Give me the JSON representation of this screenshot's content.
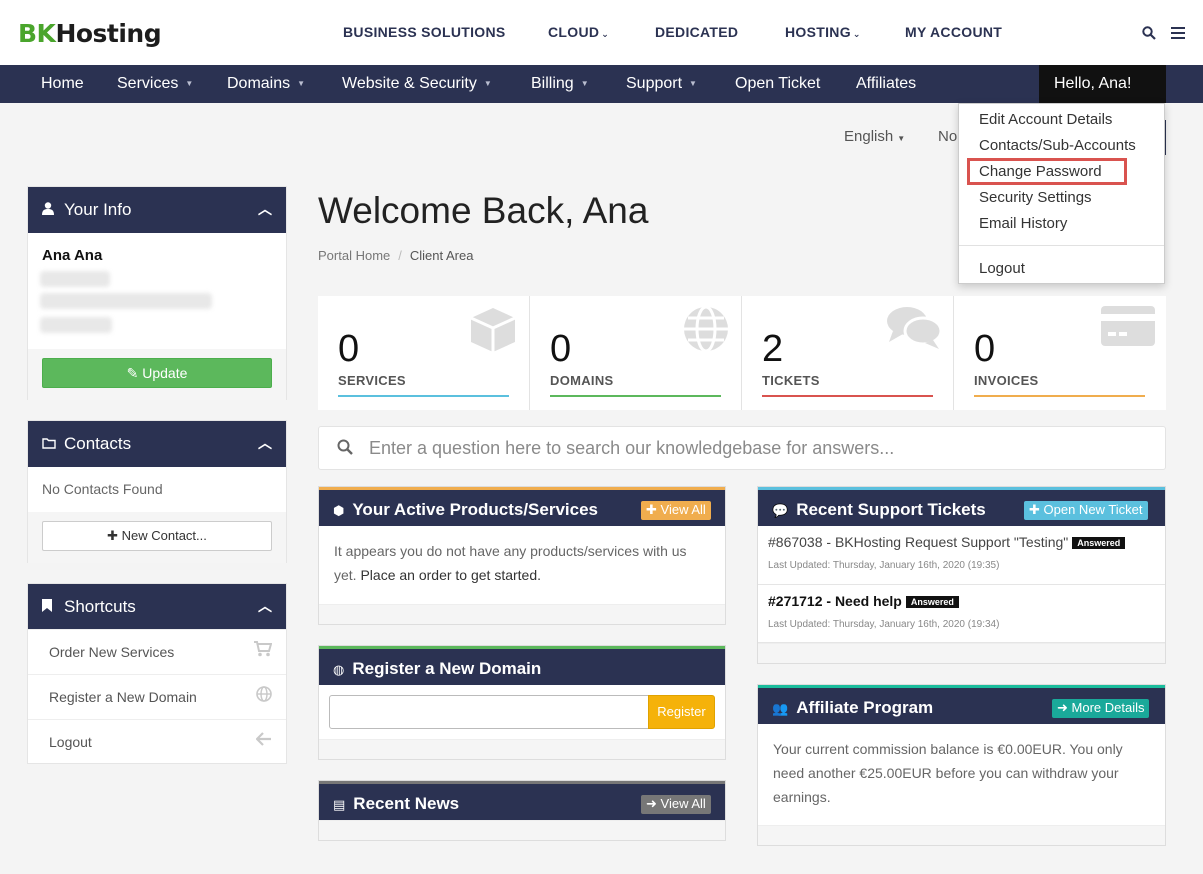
{
  "brand": {
    "bk": "BK",
    "hosting": "Hosting"
  },
  "topnav": [
    {
      "label": "BUSINESS SOLUTIONS",
      "caret": ""
    },
    {
      "label": "CLOUD",
      "caret": "⌄"
    },
    {
      "label": "DEDICATED",
      "caret": ""
    },
    {
      "label": "HOSTING",
      "caret": "⌄"
    },
    {
      "label": "MY ACCOUNT",
      "caret": ""
    }
  ],
  "mainnav": [
    {
      "label": "Home"
    },
    {
      "label": "Services",
      "caret": "▼"
    },
    {
      "label": "Domains",
      "caret": "▼"
    },
    {
      "label": "Website & Security",
      "caret": "▼"
    },
    {
      "label": "Billing",
      "caret": "▼"
    },
    {
      "label": "Support",
      "caret": "▼"
    },
    {
      "label": "Open Ticket"
    },
    {
      "label": "Affiliates"
    }
  ],
  "user_menu": {
    "hello": "Hello, Ana!",
    "items": [
      "Edit Account Details",
      "Contacts/Sub-Accounts",
      "Change Password",
      "Security Settings",
      "Email History"
    ],
    "logout": "Logout"
  },
  "language": {
    "label": "English",
    "notifications": "No"
  },
  "your_info": {
    "title": "Your Info",
    "name": "Ana Ana",
    "update": "Update"
  },
  "contacts": {
    "title": "Contacts",
    "empty": "No Contacts Found",
    "new_contact": "New Contact..."
  },
  "shortcuts": {
    "title": "Shortcuts",
    "items": [
      "Order New Services",
      "Register a New Domain",
      "Logout"
    ]
  },
  "welcome": "Welcome Back, Ana",
  "breadcrumb": {
    "home": "Portal Home",
    "current": "Client Area"
  },
  "stats": [
    {
      "value": "0",
      "label": "SERVICES",
      "color": "#5bc0de"
    },
    {
      "value": "0",
      "label": "DOMAINS",
      "color": "#5cb85c"
    },
    {
      "value": "2",
      "label": "TICKETS",
      "color": "#d9534f"
    },
    {
      "value": "0",
      "label": "INVOICES",
      "color": "#f0ad4e"
    }
  ],
  "kb_search": {
    "placeholder": "Enter a question here to search our knowledgebase for answers..."
  },
  "products": {
    "title": "Your Active Products/Services",
    "btn": "View All",
    "body": "It appears you do not have any products/services with us yet.",
    "link": "Place an order to get started."
  },
  "domain": {
    "title": "Register a New Domain",
    "btn": "Register"
  },
  "news": {
    "title": "Recent News",
    "btn": "View All"
  },
  "tickets": {
    "title": "Recent Support Tickets",
    "btn": "Open New Ticket",
    "items": [
      {
        "subject": "#867038 - BKHosting Request Support \"Testing\"",
        "status": "Answered",
        "updated": "Last Updated: Thursday, January 16th, 2020 (19:35)"
      },
      {
        "subject": "#271712 - Need help",
        "status": "Answered",
        "updated": "Last Updated: Thursday, January 16th, 2020 (19:34)"
      }
    ]
  },
  "affiliate": {
    "title": "Affiliate Program",
    "btn": "More Details",
    "body": "Your current commission balance is €0.00EUR. You only need another €25.00EUR before you can withdraw your earnings."
  }
}
